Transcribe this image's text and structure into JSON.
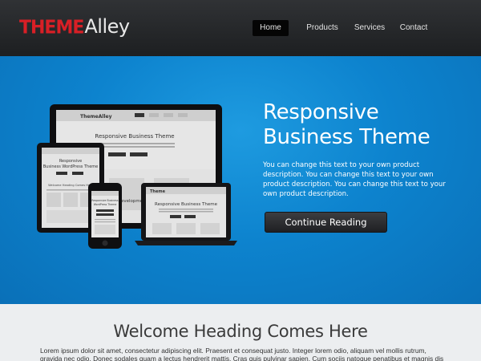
{
  "header": {
    "logo_part1": "THEME",
    "logo_part2": "Alley",
    "nav": [
      {
        "label": "Home",
        "active": true
      },
      {
        "label": "Products",
        "active": false
      },
      {
        "label": "Services",
        "active": false
      },
      {
        "label": "Contact",
        "active": false
      }
    ]
  },
  "hero": {
    "title_line1": "Responsive",
    "title_line2": "Business Theme",
    "description": "You can change this text to your own product description. You can change this text to your own product description. You can change this text to your own product description.",
    "cta_label": "Continue Reading",
    "devices": {
      "monitor_logo": "ThemeAlley",
      "monitor_title": "Responsive Business Theme",
      "tablet_title_line1": "Responsive",
      "tablet_title_line2": "Business WordPress Theme",
      "tablet_subheading": "Welcome Heading Comes Here",
      "phone_title_line1": "Responsive Business",
      "phone_title_line2": "WordPress Theme",
      "laptop_logo": "Theme",
      "laptop_title": "Responsive Business Theme",
      "side_text": "evelopment"
    }
  },
  "welcome": {
    "heading": "Welcome Heading Comes Here",
    "line1": "Lorem ipsum dolor sit amet, consectetur adipiscing elit. Praesent et consequat justo. Integer lorem odio, aliquam vel mollis rutrum,",
    "line2": "gravida nec odio. Donec sodales quam a lectus hendrerit mattis. Cras quis pulvinar sapien. Cum sociis natoque penatibus et magnis dis"
  },
  "colors": {
    "logo_red": "#d81f26",
    "hero_blue": "#0d83ce",
    "header_dark": "#262829"
  }
}
